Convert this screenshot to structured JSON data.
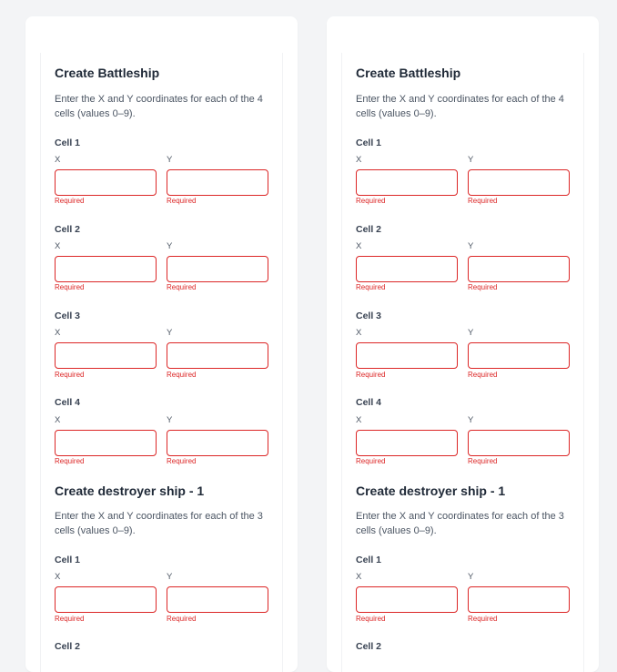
{
  "required_text": "Required",
  "x_label": "X",
  "y_label": "Y",
  "panels": [
    {
      "sections": [
        {
          "title": "Create Battleship",
          "description": "Enter the X and Y coordinates for each of the 4 cells (values 0–9).",
          "cells": [
            "Cell 1",
            "Cell 2",
            "Cell 3",
            "Cell 4"
          ]
        },
        {
          "title": "Create destroyer ship - 1",
          "description": "Enter the X and Y coordinates for each of the 3 cells (values 0–9).",
          "cells": [
            "Cell 1",
            "Cell 2"
          ]
        }
      ]
    },
    {
      "sections": [
        {
          "title": "Create Battleship",
          "description": "Enter the X and Y coordinates for each of the 4 cells (values 0–9).",
          "cells": [
            "Cell 1",
            "Cell 2",
            "Cell 3",
            "Cell 4"
          ]
        },
        {
          "title": "Create destroyer ship - 1",
          "description": "Enter the X and Y coordinates for each of the 3 cells (values 0–9).",
          "cells": [
            "Cell 1",
            "Cell 2"
          ]
        }
      ]
    }
  ],
  "colors": {
    "error": "#dc2626",
    "page_background": "#f3f4f6",
    "card_background": "#ffffff"
  }
}
